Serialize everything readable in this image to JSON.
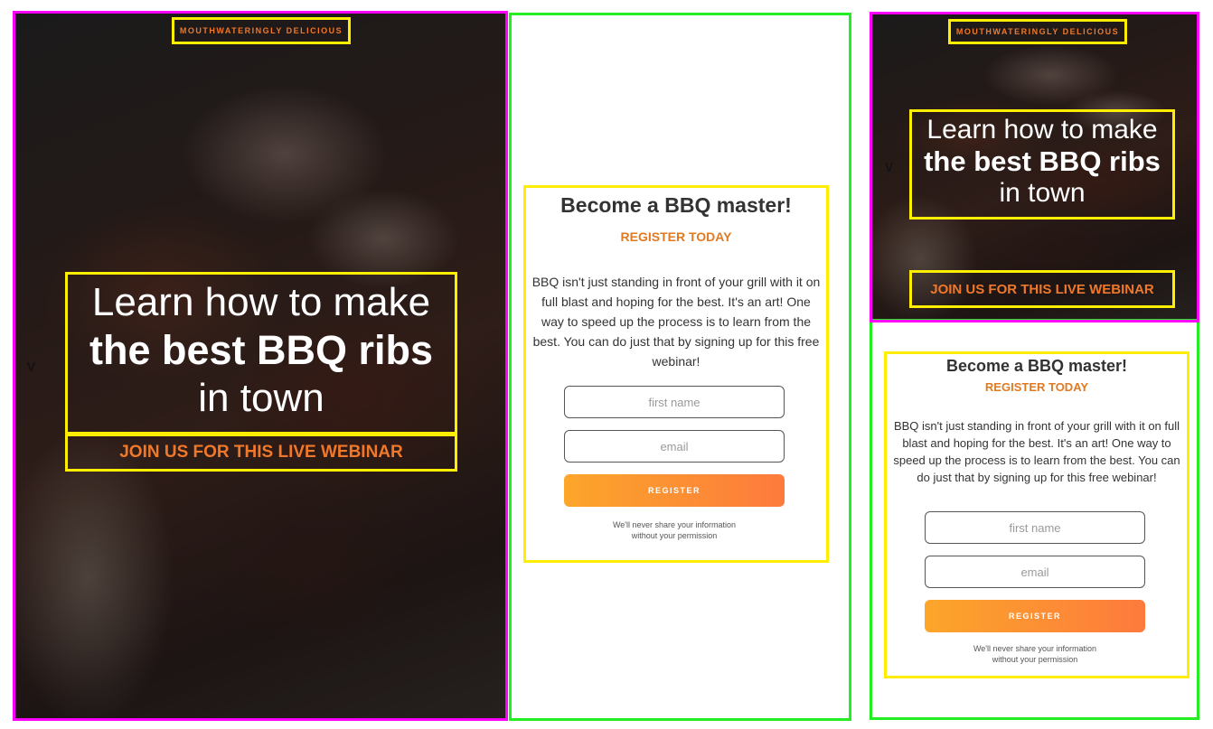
{
  "hero": {
    "eyebrow": "MOUTHWATERINGLY DELICIOUS",
    "headline_line1": "Learn how to make",
    "headline_line2": "the best BBQ ribs",
    "headline_line3": "in town",
    "cta": "JOIN US FOR THIS LIVE WEBINAR"
  },
  "form": {
    "title": "Become a BBQ master!",
    "subtitle": "REGISTER TODAY",
    "body": "BBQ isn't just standing in front of your grill with it on full blast and hoping for the best. It's an art! One way to speed up the process is to learn from the best. You can do just that by signing up for this free webinar!",
    "first_name_placeholder": "first name",
    "email_placeholder": "email",
    "button_label": "REGISTER",
    "disclaimer_line1": "We'll never share your information",
    "disclaimer_line2": "without your permission"
  },
  "markers": {
    "v": "v"
  },
  "colors": {
    "accent_orange": "#f0782a",
    "button_gradient_start": "#fca62a",
    "button_gradient_end": "#fd7a3d",
    "frame_magenta": "#ff00ff",
    "frame_green": "#22ee22",
    "frame_yellow": "#ffee00"
  }
}
